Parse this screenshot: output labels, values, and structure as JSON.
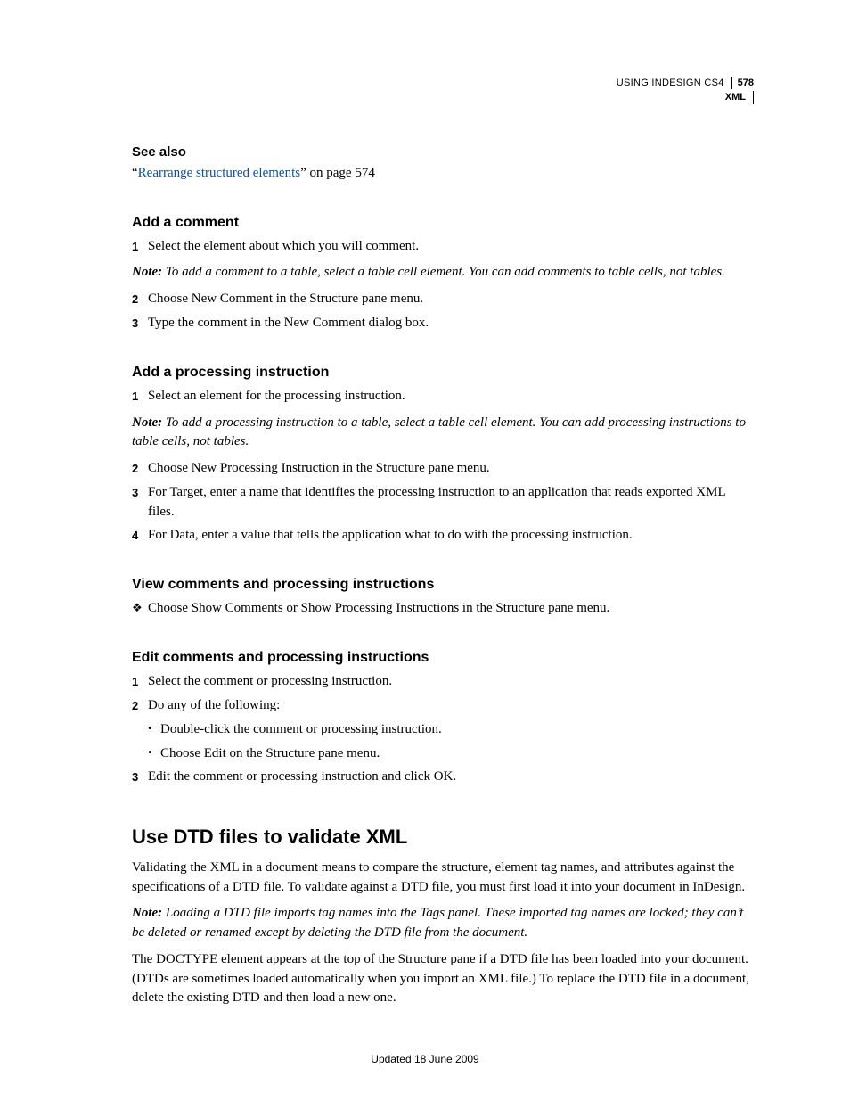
{
  "header": {
    "book": "USING INDESIGN CS4",
    "page_number": "578",
    "chapter": "XML"
  },
  "see_also": {
    "heading": "See also",
    "link_text": "Rearrange structured elements",
    "quote_open": "“",
    "quote_close": "”",
    "page_ref": " on page 574"
  },
  "sec1": {
    "heading": "Add a comment",
    "step1": "Select the element about which you will comment.",
    "note_label": "Note:",
    "note": " To add a comment to a table, select a table cell element. You can add comments to table cells, not tables.",
    "step2": "Choose New Comment in the Structure pane menu.",
    "step3": "Type the comment in the New Comment dialog box."
  },
  "sec2": {
    "heading": "Add a processing instruction",
    "step1": "Select an element for the processing instruction.",
    "note_label": "Note:",
    "note": " To add a processing instruction to a table, select a table cell element. You can add processing instructions to table cells, not tables.",
    "step2": "Choose New Processing Instruction in the Structure pane menu.",
    "step3": "For Target, enter a name that identifies the processing instruction to an application that reads exported XML files.",
    "step4": "For Data, enter a value that tells the application what to do with the processing instruction."
  },
  "sec3": {
    "heading": "View comments and processing instructions",
    "bullet": "Choose Show Comments or Show Processing Instructions in the Structure pane menu."
  },
  "sec4": {
    "heading": "Edit comments and processing instructions",
    "step1": "Select the comment or processing instruction.",
    "step2": "Do any of the following:",
    "sub1": "Double-click the comment or processing instruction.",
    "sub2": "Choose Edit on the Structure pane menu.",
    "step3": "Edit the comment or processing instruction and click OK."
  },
  "big_section": {
    "heading": "Use DTD files to validate XML",
    "para1": "Validating the XML in a document means to compare the structure, element tag names, and attributes against the specifications of a DTD file. To validate against a DTD file, you must first load it into your document in InDesign.",
    "note_label": "Note:",
    "note": " Loading a DTD file imports tag names into the Tags panel. These imported tag names are locked; they can’t be deleted or renamed except by deleting the DTD file from the document.",
    "para2": "The DOCTYPE element appears at the top of the Structure pane if a DTD file has been loaded into your document. (DTDs are sometimes loaded automatically when you import an XML file.) To replace the DTD file in a document, delete the existing DTD and then load a new one."
  },
  "footer": "Updated 18 June 2009",
  "marks": {
    "n1": "1",
    "n2": "2",
    "n3": "3",
    "n4": "4",
    "diamond": "❖",
    "dot": "•"
  }
}
